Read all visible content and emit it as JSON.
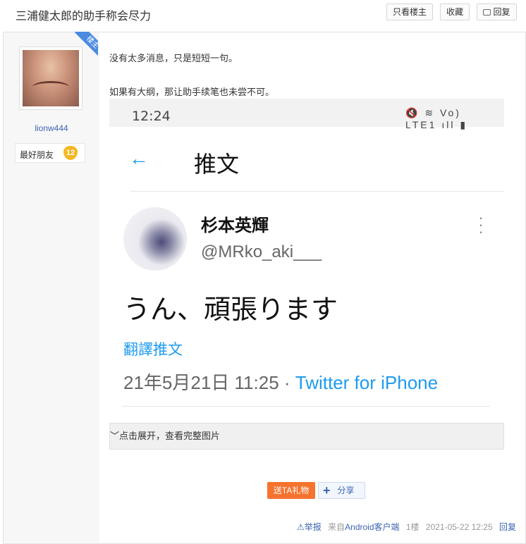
{
  "header": {
    "title": "三浦健太郎的助手称会尽力",
    "buttons": {
      "only_op": "只看楼主",
      "favorite": "收藏",
      "reply": "回复"
    }
  },
  "post": {
    "author": {
      "username": "lionw444",
      "badge": "楼主",
      "level_name": "最好朋友",
      "level": "12"
    },
    "paragraphs": [
      "没有太多消息，只是短短一句。",
      "如果有大纲，那让助手续笔也未尝不可。"
    ],
    "screenshot": {
      "status_time": "12:24",
      "status_icons": "🔇 ≋ Vo) LTE1 ıll ▮",
      "back_icon": "arrow-left-icon",
      "page_title": "推文",
      "tweet": {
        "display_name": "杉本英輝",
        "handle": "@MRko_aki___",
        "text": "うん、頑張ります",
        "translate": "翻譯推文",
        "meta_time": "21年5月21日 11:25 · ",
        "meta_source": "Twitter for iPhone"
      }
    },
    "expand_label": "点击展开，查看完整图片",
    "actions": {
      "gift": "送TA礼物",
      "share": "分享"
    },
    "footer": {
      "report": "举报",
      "from": "来自",
      "client": "Android客户端",
      "floor": "1楼",
      "datetime": "2021-05-22 12:25",
      "reply": "回复"
    }
  },
  "colors": {
    "link": "#3e65b5",
    "twitter_blue": "#1d9bf0",
    "gift": "#f5732e"
  }
}
